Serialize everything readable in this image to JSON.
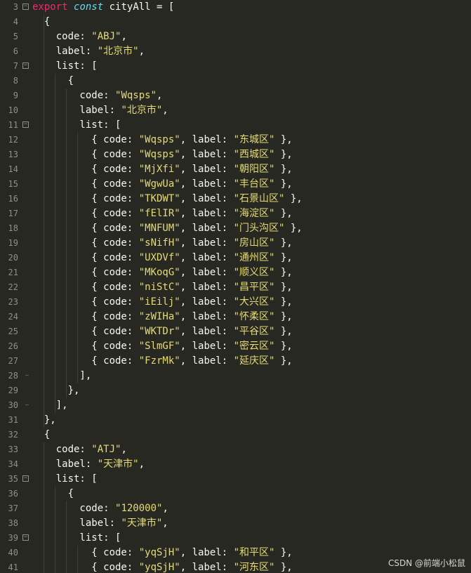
{
  "editor": {
    "theme_colors": {
      "background": "#272822",
      "keyword": "#f92672",
      "storage": "#66d9ef",
      "string": "#e6db74",
      "text": "#f8f8f2",
      "gutter_text": "#8f908a"
    },
    "lines": [
      {
        "n": "3",
        "fold": "open",
        "tokens": [
          [
            "kw",
            "export"
          ],
          [
            "op",
            " "
          ],
          [
            "st",
            "const"
          ],
          [
            "op",
            " cityAll = ["
          ]
        ]
      },
      {
        "n": "4",
        "fold": "",
        "tokens": [
          [
            "op",
            "  {"
          ]
        ]
      },
      {
        "n": "5",
        "fold": "",
        "tokens": [
          [
            "op",
            "    code: "
          ],
          [
            "str",
            "\"ABJ\""
          ],
          [
            "op",
            ","
          ]
        ]
      },
      {
        "n": "6",
        "fold": "",
        "tokens": [
          [
            "op",
            "    label: "
          ],
          [
            "str",
            "\"北京市\""
          ],
          [
            "op",
            ","
          ]
        ]
      },
      {
        "n": "7",
        "fold": "open",
        "tokens": [
          [
            "op",
            "    list: ["
          ]
        ]
      },
      {
        "n": "8",
        "fold": "",
        "tokens": [
          [
            "op",
            "      {"
          ]
        ]
      },
      {
        "n": "9",
        "fold": "",
        "tokens": [
          [
            "op",
            "        code: "
          ],
          [
            "str",
            "\"Wqsps\""
          ],
          [
            "op",
            ","
          ]
        ]
      },
      {
        "n": "10",
        "fold": "",
        "tokens": [
          [
            "op",
            "        label: "
          ],
          [
            "str",
            "\"北京市\""
          ],
          [
            "op",
            ","
          ]
        ]
      },
      {
        "n": "11",
        "fold": "open",
        "tokens": [
          [
            "op",
            "        list: ["
          ]
        ]
      },
      {
        "n": "12",
        "fold": "",
        "tokens": [
          [
            "op",
            "          { code: "
          ],
          [
            "str",
            "\"Wqsps\""
          ],
          [
            "op",
            ", label: "
          ],
          [
            "str",
            "\"东城区\""
          ],
          [
            "op",
            " },"
          ]
        ]
      },
      {
        "n": "13",
        "fold": "",
        "tokens": [
          [
            "op",
            "          { code: "
          ],
          [
            "str",
            "\"Wqsps\""
          ],
          [
            "op",
            ", label: "
          ],
          [
            "str",
            "\"西城区\""
          ],
          [
            "op",
            " },"
          ]
        ]
      },
      {
        "n": "14",
        "fold": "",
        "tokens": [
          [
            "op",
            "          { code: "
          ],
          [
            "str",
            "\"MjXfi\""
          ],
          [
            "op",
            ", label: "
          ],
          [
            "str",
            "\"朝阳区\""
          ],
          [
            "op",
            " },"
          ]
        ]
      },
      {
        "n": "15",
        "fold": "",
        "tokens": [
          [
            "op",
            "          { code: "
          ],
          [
            "str",
            "\"WgwUa\""
          ],
          [
            "op",
            ", label: "
          ],
          [
            "str",
            "\"丰台区\""
          ],
          [
            "op",
            " },"
          ]
        ]
      },
      {
        "n": "16",
        "fold": "",
        "tokens": [
          [
            "op",
            "          { code: "
          ],
          [
            "str",
            "\"TKDWT\""
          ],
          [
            "op",
            ", label: "
          ],
          [
            "str",
            "\"石景山区\""
          ],
          [
            "op",
            " },"
          ]
        ]
      },
      {
        "n": "17",
        "fold": "",
        "tokens": [
          [
            "op",
            "          { code: "
          ],
          [
            "str",
            "\"fElIR\""
          ],
          [
            "op",
            ", label: "
          ],
          [
            "str",
            "\"海淀区\""
          ],
          [
            "op",
            " },"
          ]
        ]
      },
      {
        "n": "18",
        "fold": "",
        "tokens": [
          [
            "op",
            "          { code: "
          ],
          [
            "str",
            "\"MNFUM\""
          ],
          [
            "op",
            ", label: "
          ],
          [
            "str",
            "\"门头沟区\""
          ],
          [
            "op",
            " },"
          ]
        ]
      },
      {
        "n": "19",
        "fold": "",
        "tokens": [
          [
            "op",
            "          { code: "
          ],
          [
            "str",
            "\"sNifH\""
          ],
          [
            "op",
            ", label: "
          ],
          [
            "str",
            "\"房山区\""
          ],
          [
            "op",
            " },"
          ]
        ]
      },
      {
        "n": "20",
        "fold": "",
        "tokens": [
          [
            "op",
            "          { code: "
          ],
          [
            "str",
            "\"UXDVf\""
          ],
          [
            "op",
            ", label: "
          ],
          [
            "str",
            "\"通州区\""
          ],
          [
            "op",
            " },"
          ]
        ]
      },
      {
        "n": "21",
        "fold": "",
        "tokens": [
          [
            "op",
            "          { code: "
          ],
          [
            "str",
            "\"MKoqG\""
          ],
          [
            "op",
            ", label: "
          ],
          [
            "str",
            "\"顺义区\""
          ],
          [
            "op",
            " },"
          ]
        ]
      },
      {
        "n": "22",
        "fold": "",
        "tokens": [
          [
            "op",
            "          { code: "
          ],
          [
            "str",
            "\"niStC\""
          ],
          [
            "op",
            ", label: "
          ],
          [
            "str",
            "\"昌平区\""
          ],
          [
            "op",
            " },"
          ]
        ]
      },
      {
        "n": "23",
        "fold": "",
        "tokens": [
          [
            "op",
            "          { code: "
          ],
          [
            "str",
            "\"iEilj\""
          ],
          [
            "op",
            ", label: "
          ],
          [
            "str",
            "\"大兴区\""
          ],
          [
            "op",
            " },"
          ]
        ]
      },
      {
        "n": "24",
        "fold": "",
        "tokens": [
          [
            "op",
            "          { code: "
          ],
          [
            "str",
            "\"zWIHa\""
          ],
          [
            "op",
            ", label: "
          ],
          [
            "str",
            "\"怀柔区\""
          ],
          [
            "op",
            " },"
          ]
        ]
      },
      {
        "n": "25",
        "fold": "",
        "tokens": [
          [
            "op",
            "          { code: "
          ],
          [
            "str",
            "\"WKTDr\""
          ],
          [
            "op",
            ", label: "
          ],
          [
            "str",
            "\"平谷区\""
          ],
          [
            "op",
            " },"
          ]
        ]
      },
      {
        "n": "26",
        "fold": "",
        "tokens": [
          [
            "op",
            "          { code: "
          ],
          [
            "str",
            "\"SlmGF\""
          ],
          [
            "op",
            ", label: "
          ],
          [
            "str",
            "\"密云区\""
          ],
          [
            "op",
            " },"
          ]
        ]
      },
      {
        "n": "27",
        "fold": "",
        "tokens": [
          [
            "op",
            "          { code: "
          ],
          [
            "str",
            "\"FzrMk\""
          ],
          [
            "op",
            ", label: "
          ],
          [
            "str",
            "\"延庆区\""
          ],
          [
            "op",
            " },"
          ]
        ]
      },
      {
        "n": "28",
        "fold": "end",
        "tokens": [
          [
            "op",
            "        ],"
          ]
        ]
      },
      {
        "n": "29",
        "fold": "",
        "tokens": [
          [
            "op",
            "      },"
          ]
        ]
      },
      {
        "n": "30",
        "fold": "end",
        "tokens": [
          [
            "op",
            "    ],"
          ]
        ]
      },
      {
        "n": "31",
        "fold": "",
        "tokens": [
          [
            "op",
            "  },"
          ]
        ]
      },
      {
        "n": "32",
        "fold": "",
        "tokens": [
          [
            "op",
            "  {"
          ]
        ]
      },
      {
        "n": "33",
        "fold": "",
        "tokens": [
          [
            "op",
            "    code: "
          ],
          [
            "str",
            "\"ATJ\""
          ],
          [
            "op",
            ","
          ]
        ]
      },
      {
        "n": "34",
        "fold": "",
        "tokens": [
          [
            "op",
            "    label: "
          ],
          [
            "str",
            "\"天津市\""
          ],
          [
            "op",
            ","
          ]
        ]
      },
      {
        "n": "35",
        "fold": "open",
        "tokens": [
          [
            "op",
            "    list: ["
          ]
        ]
      },
      {
        "n": "36",
        "fold": "",
        "tokens": [
          [
            "op",
            "      {"
          ]
        ]
      },
      {
        "n": "37",
        "fold": "",
        "tokens": [
          [
            "op",
            "        code: "
          ],
          [
            "str",
            "\"120000\""
          ],
          [
            "op",
            ","
          ]
        ]
      },
      {
        "n": "38",
        "fold": "",
        "tokens": [
          [
            "op",
            "        label: "
          ],
          [
            "str",
            "\"天津市\""
          ],
          [
            "op",
            ","
          ]
        ]
      },
      {
        "n": "39",
        "fold": "open",
        "tokens": [
          [
            "op",
            "        list: ["
          ]
        ]
      },
      {
        "n": "40",
        "fold": "",
        "tokens": [
          [
            "op",
            "          { code: "
          ],
          [
            "str",
            "\"yqSjH\""
          ],
          [
            "op",
            ", label: "
          ],
          [
            "str",
            "\"和平区\""
          ],
          [
            "op",
            " },"
          ]
        ]
      },
      {
        "n": "41",
        "fold": "",
        "tokens": [
          [
            "op",
            "          { code: "
          ],
          [
            "str",
            "\"yqSjH\""
          ],
          [
            "op",
            ", label: "
          ],
          [
            "str",
            "\"河东区\""
          ],
          [
            "op",
            " },"
          ]
        ]
      }
    ]
  },
  "watermark": "CSDN @前端小松鼠"
}
